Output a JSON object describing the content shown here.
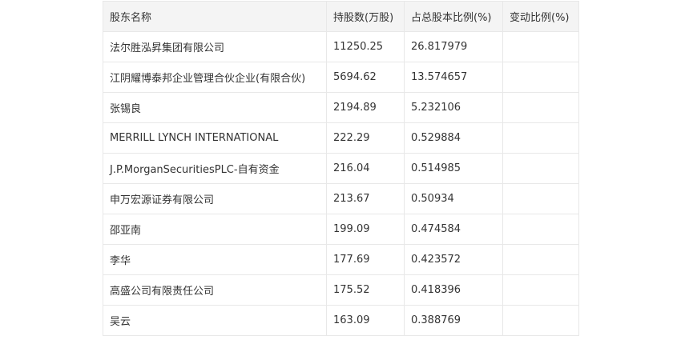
{
  "table": {
    "headers": [
      "股东名称",
      "持股数(万股)",
      "占总股本比例(%)",
      "变动比例(%)"
    ],
    "rows": [
      {
        "name": "法尔胜泓昇集团有限公司",
        "shares": "11250.25",
        "ratio": "26.817979",
        "change": ""
      },
      {
        "name": "江阴耀博泰邦企业管理合伙企业(有限合伙)",
        "shares": "5694.62",
        "ratio": "13.574657",
        "change": ""
      },
      {
        "name": "张锡良",
        "shares": "2194.89",
        "ratio": "5.232106",
        "change": ""
      },
      {
        "name": "MERRILL LYNCH INTERNATIONAL",
        "shares": "222.29",
        "ratio": "0.529884",
        "change": ""
      },
      {
        "name": "J.P.MorganSecuritiesPLC-自有资金",
        "shares": "216.04",
        "ratio": "0.514985",
        "change": ""
      },
      {
        "name": "申万宏源证券有限公司",
        "shares": "213.67",
        "ratio": "0.50934",
        "change": ""
      },
      {
        "name": "邵亚南",
        "shares": "199.09",
        "ratio": "0.474584",
        "change": ""
      },
      {
        "name": "李华",
        "shares": "177.69",
        "ratio": "0.423572",
        "change": ""
      },
      {
        "name": "高盛公司有限责任公司",
        "shares": "175.52",
        "ratio": "0.418396",
        "change": ""
      },
      {
        "name": "吴云",
        "shares": "163.09",
        "ratio": "0.388769",
        "change": ""
      }
    ]
  }
}
